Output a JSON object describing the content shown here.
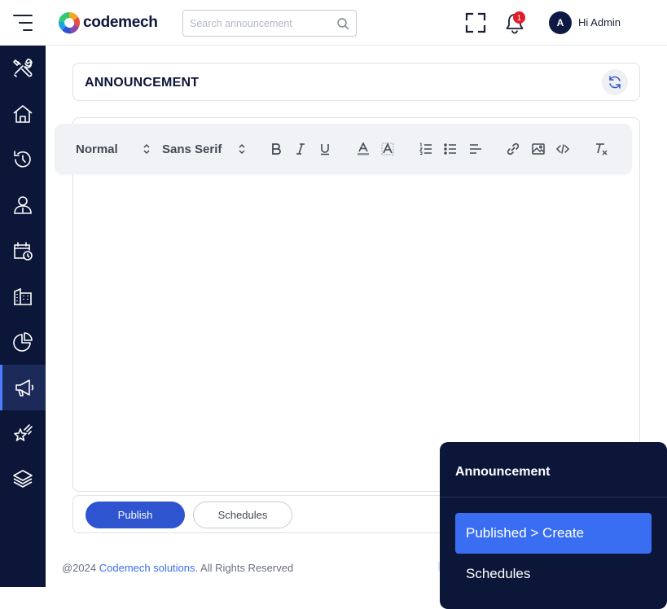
{
  "header": {
    "brand": "codemech",
    "search_placeholder": "Search announcement",
    "notification_count": "1",
    "avatar_initial": "A",
    "greeting": "Hi Admin"
  },
  "sidebar": {
    "items": [
      {
        "icon": "tools-icon",
        "active": false
      },
      {
        "icon": "home-icon",
        "active": false
      },
      {
        "icon": "history-icon",
        "active": false
      },
      {
        "icon": "user-icon",
        "active": false
      },
      {
        "icon": "calendar-clock-icon",
        "active": false
      },
      {
        "icon": "building-icon",
        "active": false
      },
      {
        "icon": "pie-chart-icon",
        "active": false
      },
      {
        "icon": "megaphone-icon",
        "active": true
      },
      {
        "icon": "star-icon",
        "active": false
      },
      {
        "icon": "layers-icon",
        "active": false
      }
    ]
  },
  "page": {
    "title": "ANNOUNCEMENT"
  },
  "editor": {
    "format_select": "Normal",
    "font_select": "Sans Serif"
  },
  "actions": {
    "publish_label": "Publish",
    "schedules_label": "Schedules"
  },
  "footer": {
    "copyright": "@2024 ",
    "company": "Codemech solutions",
    "rights": ". All Rights Reserved"
  },
  "popover": {
    "title": "Announcement",
    "items": [
      {
        "label": "Published > Create",
        "active": true
      },
      {
        "label": "Schedules",
        "active": false
      }
    ]
  },
  "colors": {
    "sidebar_bg": "#0c1638",
    "accent": "#3a6ef2",
    "publish_button": "#2f54d0",
    "badge": "#e11d2a"
  }
}
